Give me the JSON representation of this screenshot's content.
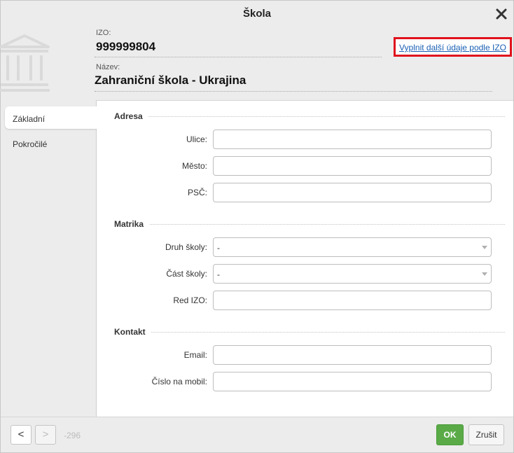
{
  "dialog": {
    "title": "Škola",
    "close_icon": "close-icon"
  },
  "header": {
    "icon": "school-building-icon",
    "izo_label": "IZO:",
    "izo_value": "999999804",
    "name_label": "Název:",
    "name_value": "Zahraniční škola - Ukrajina",
    "fill_link": "Vyplnit další údaje podle IZO",
    "highlight_color": "#e0121d"
  },
  "tabs": [
    {
      "label": "Základní",
      "active": true
    },
    {
      "label": "Pokročilé",
      "active": false
    }
  ],
  "sections": {
    "address": {
      "title": "Adresa",
      "street_label": "Ulice:",
      "street_value": "",
      "city_label": "Město:",
      "city_value": "",
      "zip_label": "PSČ:",
      "zip_value": ""
    },
    "registry": {
      "title": "Matrika",
      "school_type_label": "Druh školy:",
      "school_type_value": "-",
      "school_part_label": "Část školy:",
      "school_part_value": "-",
      "red_izo_label": "Red IZO:",
      "red_izo_value": ""
    },
    "contact": {
      "title": "Kontakt",
      "email_label": "Email:",
      "email_value": "",
      "mobile_label": "Číslo na mobil:",
      "mobile_value": ""
    }
  },
  "footer": {
    "prev_label": "<",
    "next_label": ">",
    "record_number": "-296",
    "ok_label": "OK",
    "cancel_label": "Zrušit",
    "ok_color": "#5aab47"
  }
}
